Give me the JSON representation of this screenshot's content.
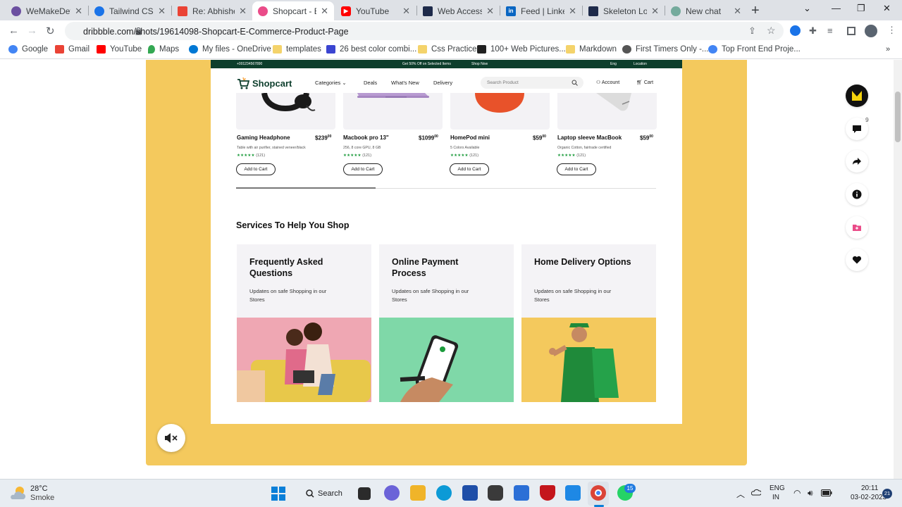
{
  "browser": {
    "tabs": [
      {
        "title": "WeMakeDevs",
        "color": "#6b4fa0"
      },
      {
        "title": "Tailwind CSS S",
        "color": "#1a73e8"
      },
      {
        "title": "Re: Abhishek I",
        "color": "#ea4335"
      },
      {
        "title": "Shopcart - E-C",
        "color": "#ea4c89"
      },
      {
        "title": "YouTube",
        "color": "#ff0000"
      },
      {
        "title": "Web Accessibi",
        "color": "#1e2a4a"
      },
      {
        "title": "Feed | LinkedI",
        "color": "#0a66c2"
      },
      {
        "title": "Skeleton Load",
        "color": "#1e2a4a"
      },
      {
        "title": "New chat",
        "color": "#74aa9c"
      }
    ],
    "active_tab": 3,
    "url": "dribbble.com/shots/19614098-Shopcart-E-Commerce-Product-Page",
    "bookmarks": [
      {
        "label": "Google",
        "color": "#4285f4"
      },
      {
        "label": "Gmail",
        "color": "#ea4335"
      },
      {
        "label": "YouTube",
        "color": "#ff0000"
      },
      {
        "label": "Maps",
        "color": "#34a853"
      },
      {
        "label": "My files - OneDrive",
        "color": "#0078d4"
      },
      {
        "label": "templates",
        "color": "#f4d36b"
      },
      {
        "label": "26 best color combi...",
        "color": "#3b45d1"
      },
      {
        "label": "Css Practice",
        "color": "#f4d36b"
      },
      {
        "label": "100+ Web Pictures...",
        "color": "#222222"
      },
      {
        "label": "Markdown",
        "color": "#f4d36b"
      },
      {
        "label": "First Timers Only -...",
        "color": "#555555"
      },
      {
        "label": "Top Front End Proje...",
        "color": "#4285f4"
      }
    ]
  },
  "shopcart": {
    "promo": {
      "phone": "+001234567890",
      "offer": "Get 50% Off on Selected Items",
      "shop_now": "Shop Now",
      "lang": "Eng",
      "location": "Location"
    },
    "logo": "Shopcart",
    "nav": [
      "Categories",
      "Deals",
      "What's New",
      "Delivery"
    ],
    "search_placeholder": "Search Product",
    "account": "Account",
    "cart": "Cart",
    "products": [
      {
        "name": "Gaming Headphone",
        "price": "$239",
        "cents": "00",
        "desc": "Table with air purifier, stained veneer/black",
        "rating": "(121)"
      },
      {
        "name": "Macbook pro 13\"",
        "price": "$1099",
        "cents": "00",
        "desc": "256, 8 core GPU, 8 GB",
        "rating": "(121)"
      },
      {
        "name": "HomePod mini",
        "price": "$59",
        "cents": "00",
        "desc": "5 Colors Available",
        "rating": "(121)"
      },
      {
        "name": "Laptop sleeve MacBook",
        "price": "$59",
        "cents": "00",
        "desc": "Organic Cotton, fairtrade certified",
        "rating": "(121)"
      }
    ],
    "add_to_cart": "Add to Cart",
    "services_title": "Services To Help You Shop",
    "services": [
      {
        "title": "Frequently Asked Questions",
        "desc": "Updates on safe Shopping in our Stores",
        "bg": "#efa7b3"
      },
      {
        "title": "Online Payment Process",
        "desc": "Updates on safe Shopping in our Stores",
        "bg": "#7fd8a8"
      },
      {
        "title": "Home Delivery Options",
        "desc": "Updates on safe Shopping in our Stores",
        "bg": "#f4c95d"
      }
    ]
  },
  "rail": {
    "comments_count": "9"
  },
  "taskbar": {
    "weather_temp": "28°C",
    "weather_desc": "Smoke",
    "search": "Search",
    "lang1": "ENG",
    "lang2": "IN",
    "time": "20:11",
    "date": "03-02-2023",
    "whatsapp_badge": "15",
    "notif_badge": "21"
  }
}
